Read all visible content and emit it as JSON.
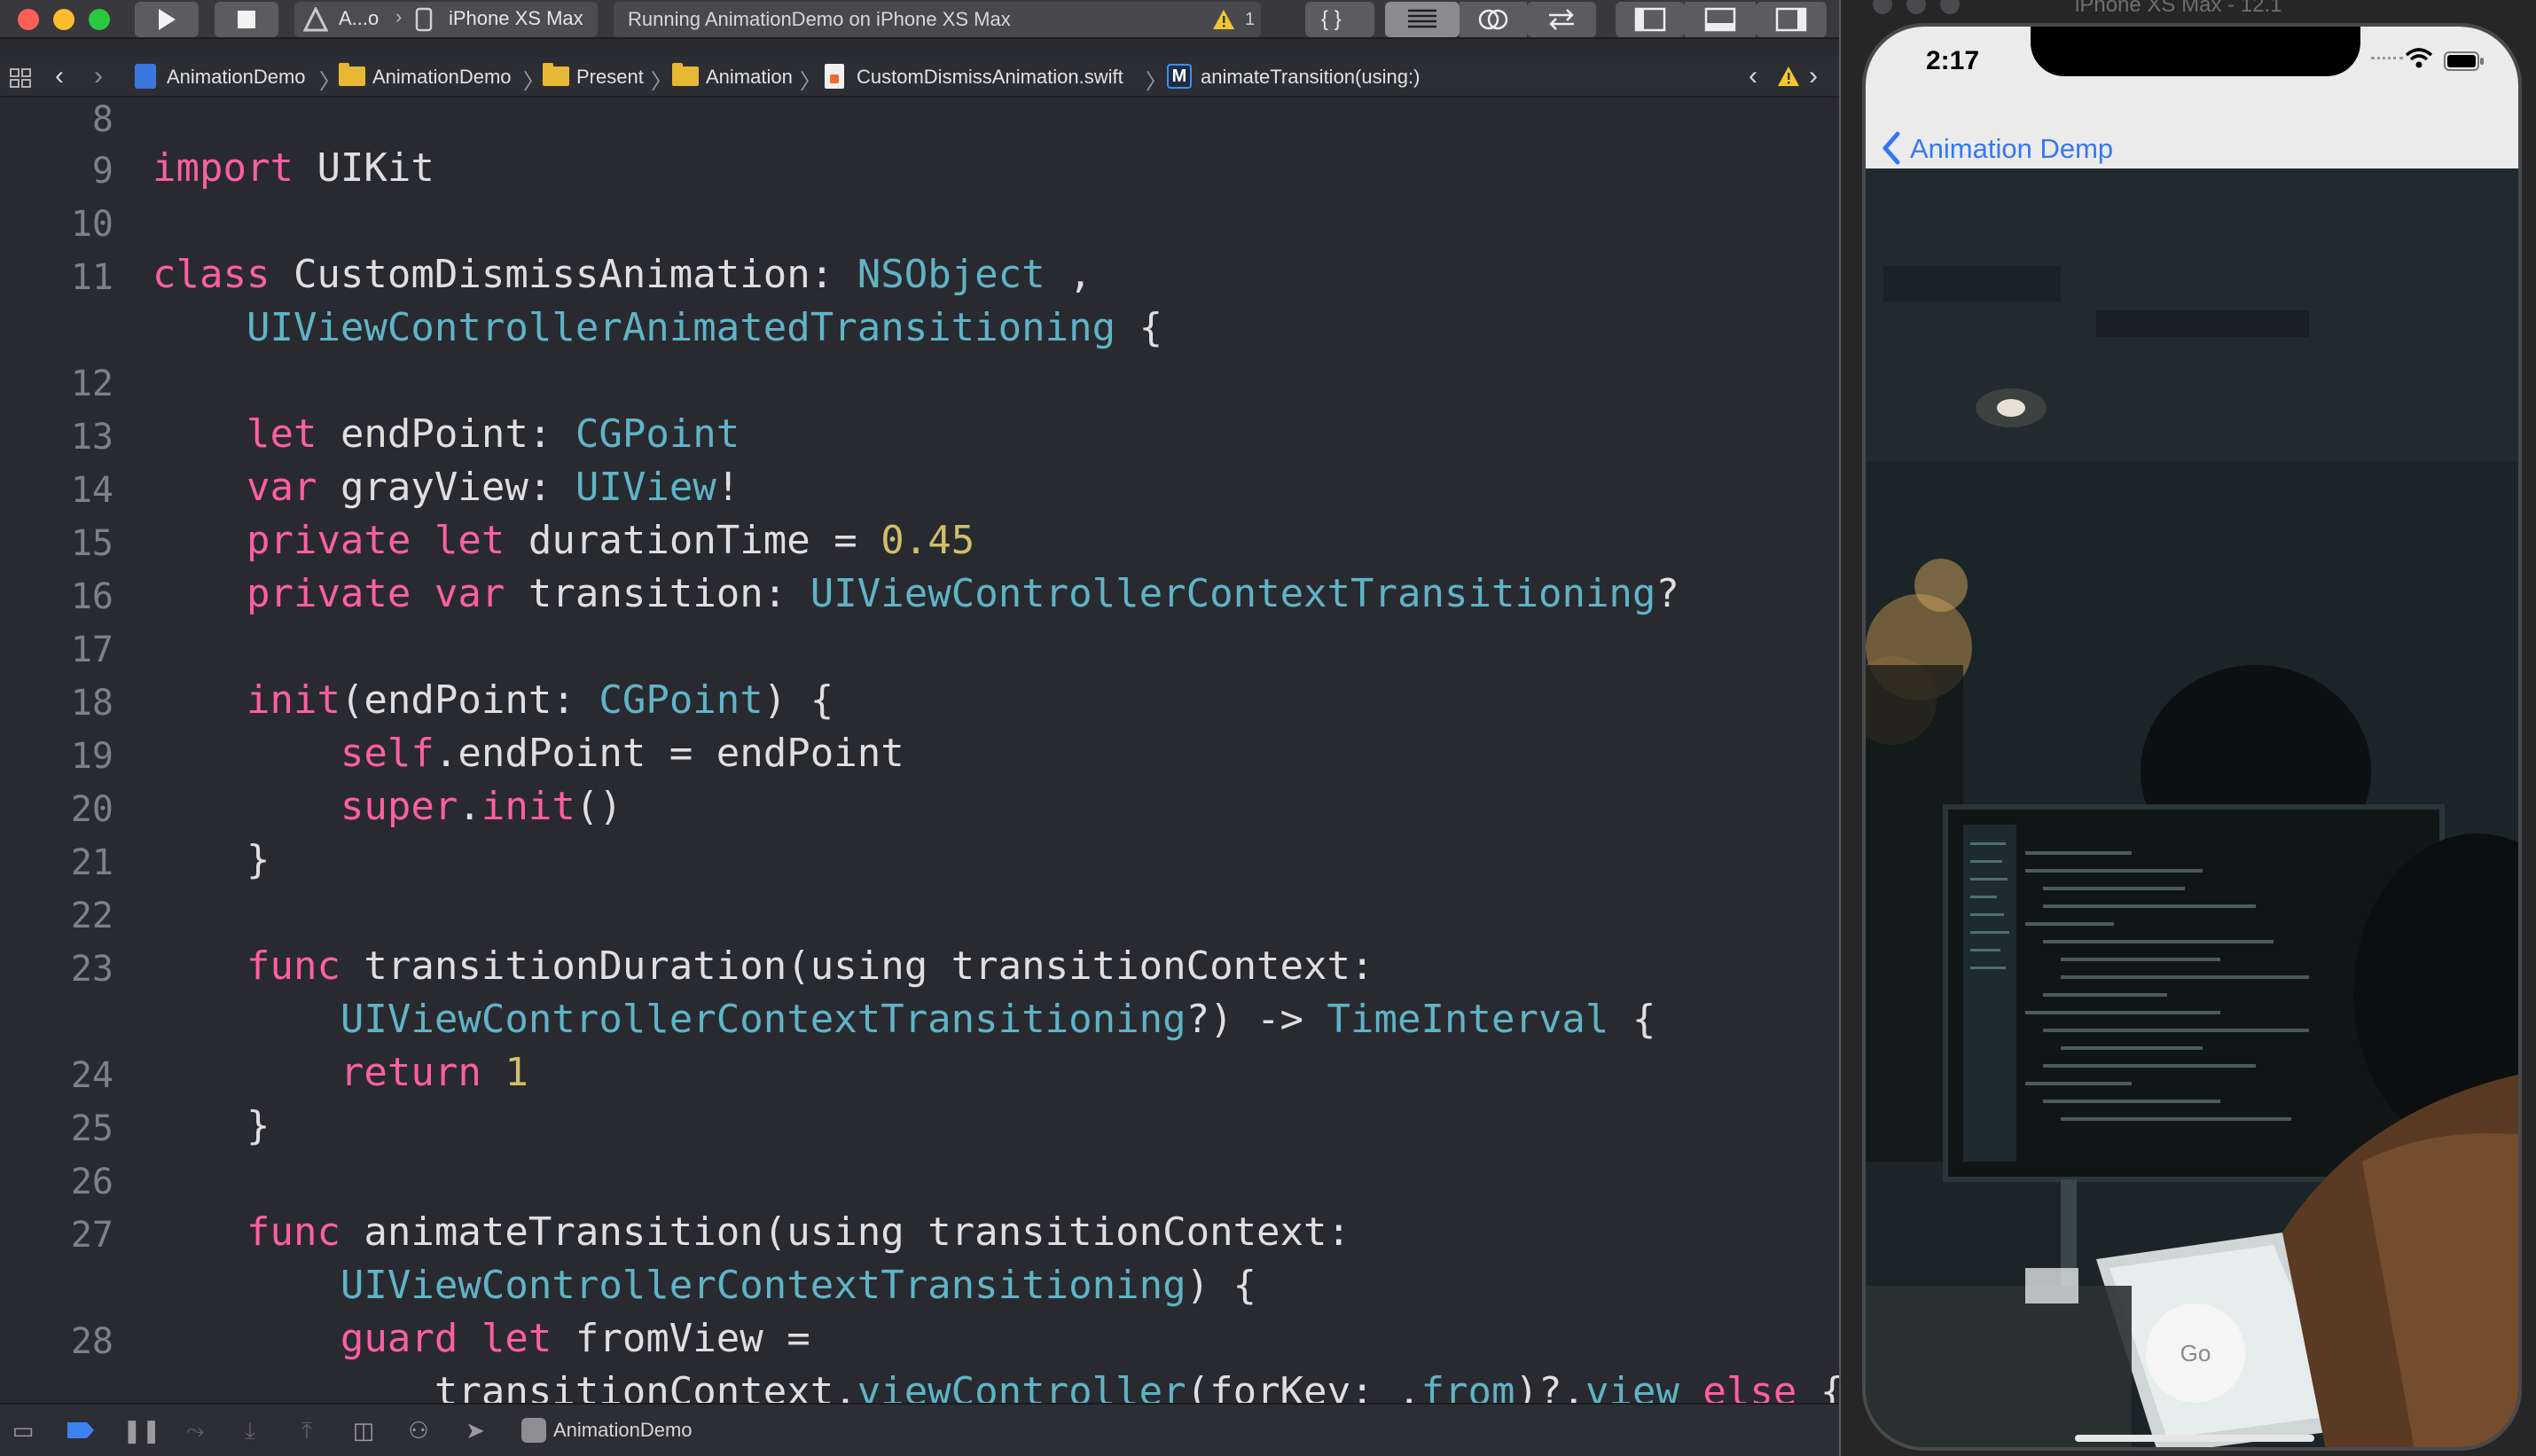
{
  "toolbar": {
    "scheme": "A...o",
    "device": "iPhone XS Max",
    "status": "Running AnimationDemo on iPhone XS Max",
    "warning_count": "1",
    "braces_label": "{ }"
  },
  "breadcrumbs": {
    "project": "AnimationDemo",
    "group": "AnimationDemo",
    "folder_present": "Present",
    "folder_animation": "Animation",
    "file": "CustomDismissAnimation.swift",
    "method_badge": "M",
    "method": "animateTransition(using:)"
  },
  "editor": {
    "lines": [
      {
        "n": "8",
        "text": ""
      },
      {
        "n": "9",
        "text": "import UIKit"
      },
      {
        "n": "10",
        "text": ""
      },
      {
        "n": "11",
        "text": "class CustomDismissAnimation: NSObject ,"
      },
      {
        "n": "",
        "text": "    UIViewControllerAnimatedTransitioning {"
      },
      {
        "n": "12",
        "text": ""
      },
      {
        "n": "13",
        "text": "    let endPoint: CGPoint"
      },
      {
        "n": "14",
        "text": "    var grayView: UIView!"
      },
      {
        "n": "15",
        "text": "    private let durationTime = 0.45"
      },
      {
        "n": "16",
        "text": "    private var transition: UIViewControllerContextTransitioning?"
      },
      {
        "n": "17",
        "text": ""
      },
      {
        "n": "18",
        "text": "    init(endPoint: CGPoint) {"
      },
      {
        "n": "19",
        "text": "        self.endPoint = endPoint"
      },
      {
        "n": "20",
        "text": "        super.init()"
      },
      {
        "n": "21",
        "text": "    }"
      },
      {
        "n": "22",
        "text": ""
      },
      {
        "n": "23",
        "text": "    func transitionDuration(using transitionContext:"
      },
      {
        "n": "",
        "text": "        UIViewControllerContextTransitioning?) -> TimeInterval {"
      },
      {
        "n": "24",
        "text": "        return 1"
      },
      {
        "n": "25",
        "text": "    }"
      },
      {
        "n": "26",
        "text": ""
      },
      {
        "n": "27",
        "text": "    func animateTransition(using transitionContext:"
      },
      {
        "n": "",
        "text": "        UIViewControllerContextTransitioning) {"
      },
      {
        "n": "28",
        "text": "        guard let fromView ="
      },
      {
        "n": "",
        "text": "            transitionContext.viewController(forKey: .from)?.view else {"
      }
    ]
  },
  "debugbar": {
    "target": "AnimationDemo"
  },
  "simulator": {
    "window_title": "iPhone XS Max - 12.1",
    "time": "2:17",
    "back_label": "Animation Demp",
    "go_button": "Go"
  },
  "colors": {
    "keyword": "#fc5fa3",
    "type": "#5dd8ff",
    "number": "#d0bf69",
    "property": "#ef8e6a",
    "ios_blue": "#3478f6"
  }
}
